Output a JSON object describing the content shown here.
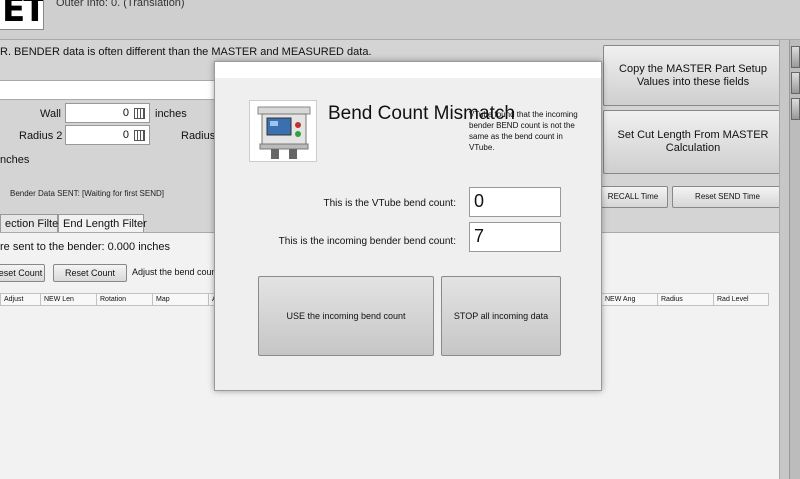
{
  "app": {
    "logo_text": "ET",
    "top_info": "Outer Info: 0. (Translation)",
    "info_line": "R.  BENDER data is often different than the MASTER and MEASURED data."
  },
  "fields": {
    "wall_label": "Wall",
    "wall_value": "0",
    "wall_unit": "inches",
    "radius2_label": "Radius 2",
    "radius2_value": "0",
    "radius_label": "Radius",
    "inches_label": "nches"
  },
  "status": {
    "bender_sent": "Bender Data SENT:  [Waiting for first SEND]"
  },
  "tabs": [
    "ection Filter",
    "End Length Filter"
  ],
  "panel": {
    "sent_to_bender": "re sent to the bender:  0.000  inches",
    "reset_count_1": "eset Count",
    "reset_count_2": "Reset Count",
    "adjust_label": "Adjust the bend count"
  },
  "grid": {
    "left_headers": [
      "Adjust",
      "NEW Len",
      "Rotation",
      "Map",
      "A"
    ],
    "right_headers": [
      "NEW Ang",
      "Radius",
      "Rad Level"
    ]
  },
  "right_buttons": {
    "copy_master": "Copy the MASTER Part Setup Values into these fields",
    "set_cut_length": "Set Cut Length From MASTER Calculation",
    "recall_time": "RECALL Time",
    "reset_send_time": "Reset SEND Time"
  },
  "dialog": {
    "title": "Bend Count Mismatch",
    "description": "VTube found that the incoming bender BEND count is not the same as the bend count in VTube.",
    "vtube_label": "This is the VTube bend count:",
    "vtube_value": "0",
    "incoming_label": "This is the incoming bender bend count:",
    "incoming_value": "7",
    "use_button": "USE the incoming bend count",
    "stop_button": "STOP all incoming data"
  },
  "colors": {
    "background": "#d4d4d4",
    "dialog_bg": "#efefef",
    "button_gray": "#cfcfcf"
  }
}
